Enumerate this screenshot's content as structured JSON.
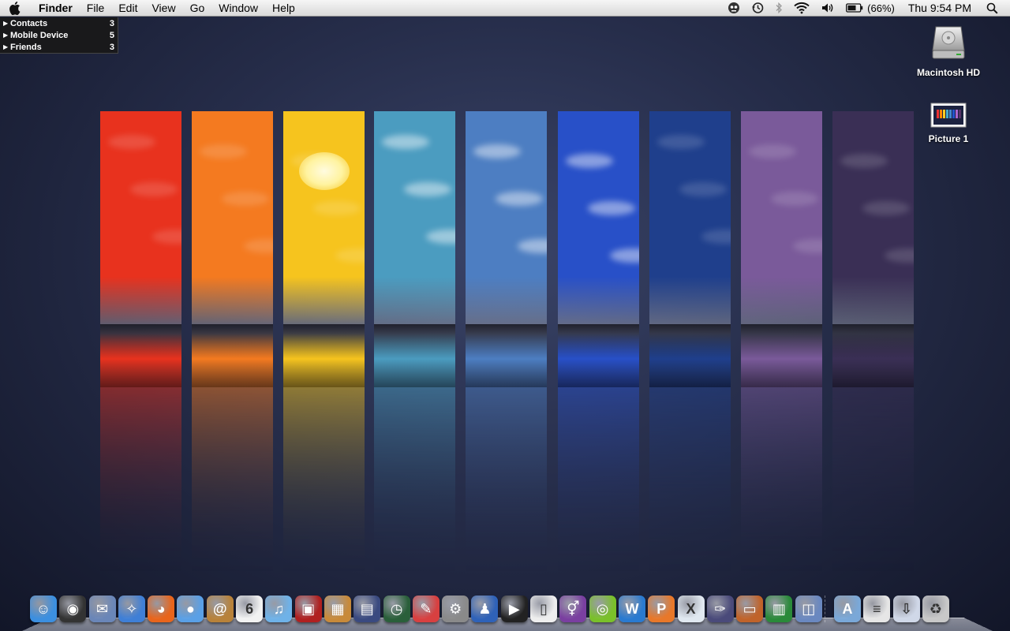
{
  "menubar": {
    "app_name": "Finder",
    "menus": [
      "File",
      "Edit",
      "View",
      "Go",
      "Window",
      "Help"
    ],
    "battery": "(66%)",
    "clock": "Thu 9:54 PM"
  },
  "contacts_widget": {
    "groups": [
      {
        "name": "Contacts",
        "count": "3"
      },
      {
        "name": "Mobile Device",
        "count": "5"
      },
      {
        "name": "Friends",
        "count": "3"
      }
    ]
  },
  "desktop_icons": [
    {
      "label": "Macintosh HD",
      "icon": "hard-drive-icon"
    },
    {
      "label": "Picture 1",
      "icon": "screenshot-thumbnail-icon"
    }
  ],
  "wallpaper": {
    "panel_colors": [
      "#e8321e",
      "#f47a20",
      "#f6c41e",
      "#4b9cc0",
      "#4d7ec2",
      "#2850c8",
      "#1f3f8c",
      "#7a5a9a",
      "#3a2f55"
    ]
  },
  "dock": {
    "apps": [
      {
        "icon": "finder-icon",
        "color": "#3c8fe0",
        "glyph": "☺"
      },
      {
        "icon": "dashboard-icon",
        "color": "#333",
        "glyph": "◉"
      },
      {
        "icon": "mail-icon",
        "color": "#6a86b8",
        "glyph": "✉"
      },
      {
        "icon": "safari-icon",
        "color": "#3f7fd6",
        "glyph": "✧"
      },
      {
        "icon": "firefox-icon",
        "color": "#e8651c",
        "glyph": "◕"
      },
      {
        "icon": "ichat-icon",
        "color": "#5aa0e6",
        "glyph": "●"
      },
      {
        "icon": "address-book-icon",
        "color": "#b8823a",
        "glyph": "@"
      },
      {
        "icon": "ical-icon",
        "color": "#f2f2f2",
        "glyph": "6"
      },
      {
        "icon": "itunes-icon",
        "color": "#6fb2e8",
        "glyph": "♫"
      },
      {
        "icon": "photo-booth-icon",
        "color": "#b02020",
        "glyph": "▣"
      },
      {
        "icon": "iphoto-icon",
        "color": "#c88a3a",
        "glyph": "▦"
      },
      {
        "icon": "spaces-icon",
        "color": "#3a4a80",
        "glyph": "▤"
      },
      {
        "icon": "time-machine-icon",
        "color": "#2a5f3a",
        "glyph": "◷"
      },
      {
        "icon": "preview-icon",
        "color": "#d84040",
        "glyph": "✎"
      },
      {
        "icon": "system-preferences-icon",
        "color": "#8a8a8a",
        "glyph": "⚙"
      },
      {
        "icon": "adium-icon",
        "color": "#2f62b8",
        "glyph": "♟"
      },
      {
        "icon": "quicktime-icon",
        "color": "#222",
        "glyph": "▶"
      },
      {
        "icon": "dictionary-icon",
        "color": "#eeeeee",
        "glyph": "▯"
      },
      {
        "icon": "gender-icon",
        "color": "#7a3fa0",
        "glyph": "⚥"
      },
      {
        "icon": "limewire-icon",
        "color": "#7ac02a",
        "glyph": "◎"
      },
      {
        "icon": "word-icon",
        "color": "#2a7ad0",
        "glyph": "W"
      },
      {
        "icon": "powerpoint-icon",
        "color": "#e8782a",
        "glyph": "P"
      },
      {
        "icon": "excel-icon",
        "color": "#e0e8f0",
        "glyph": "X"
      },
      {
        "icon": "script-editor-icon",
        "color": "#4a4a7a",
        "glyph": "✑"
      },
      {
        "icon": "keynote-icon",
        "color": "#c0632a",
        "glyph": "▭"
      },
      {
        "icon": "numbers-icon",
        "color": "#2a8a3a",
        "glyph": "▥"
      },
      {
        "icon": "image-capture-icon",
        "color": "#6a88c0",
        "glyph": "◫"
      }
    ],
    "stacks": [
      {
        "icon": "applications-folder-icon",
        "color": "#7aa8d8",
        "glyph": "A"
      },
      {
        "icon": "documents-stack-icon",
        "color": "#e6e6e6",
        "glyph": "≡"
      },
      {
        "icon": "downloads-stack-icon",
        "color": "#d0d8e8",
        "glyph": "⇩"
      },
      {
        "icon": "trash-icon",
        "color": "#c8c8c8",
        "glyph": "♻"
      }
    ]
  }
}
